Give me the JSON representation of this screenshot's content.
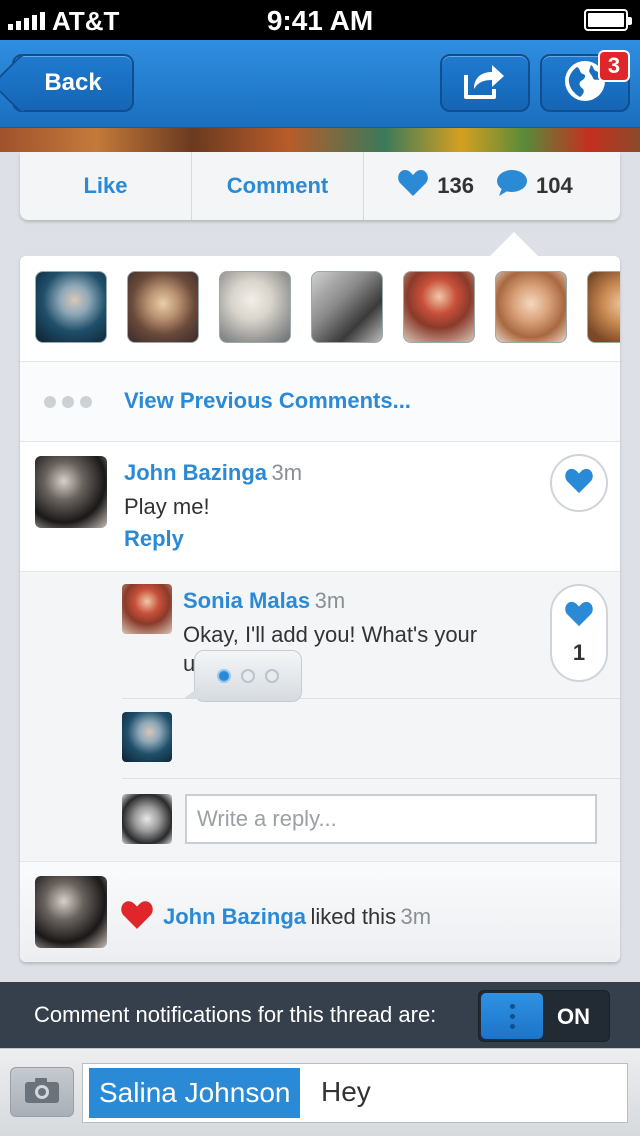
{
  "status_bar": {
    "carrier": "AT&T",
    "time": "9:41 AM"
  },
  "nav": {
    "back_label": "Back",
    "notification_badge": "3",
    "share_icon": "share-icon",
    "globe_icon": "globe-icon"
  },
  "actions": {
    "like_label": "Like",
    "comment_label": "Comment",
    "likes_count": "136",
    "comments_count": "104"
  },
  "liker_avatars": [
    "avatar-1",
    "avatar-2",
    "avatar-3",
    "avatar-4",
    "avatar-5",
    "avatar-6",
    "avatar-7"
  ],
  "view_previous": "View Previous Comments...",
  "comment": {
    "author": "John Bazinga",
    "time": "3m",
    "text": "Play me!",
    "reply_label": "Reply"
  },
  "reply": {
    "author": "Sonia Malas",
    "time": "3m",
    "text": "Okay, I'll add you! What's your username?",
    "like_count": "1"
  },
  "reply_input": {
    "placeholder": "Write a reply..."
  },
  "activity": {
    "author": "John Bazinga",
    "action": "liked this",
    "time": "3m"
  },
  "notifications": {
    "text": "Comment notifications for this thread are:",
    "state": "ON"
  },
  "compose": {
    "mention": "Salina Johnson",
    "text": "Hey"
  },
  "colors": {
    "accent": "#2a8ad6",
    "nav": "#1b6fbf",
    "heart_red": "#e0262b",
    "notif_bar": "#36404c"
  }
}
